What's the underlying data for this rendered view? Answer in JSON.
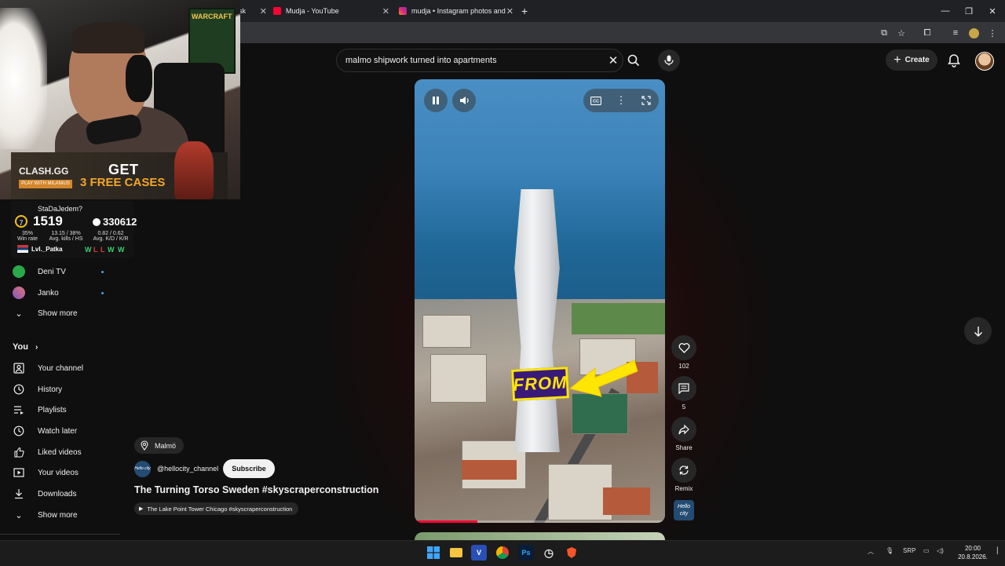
{
  "browser": {
    "tabs": [
      {
        "label": "sk",
        "active": true
      },
      {
        "label": "Mudja - YouTube",
        "active": false
      },
      {
        "label": "mudja • Instagram photos and",
        "active": false
      }
    ],
    "new_tab": "+"
  },
  "youtube": {
    "search": {
      "query": "malmo shipwork turned into apartments"
    },
    "create_label": "Create"
  },
  "stream_overlay": {
    "ad_logo": "CLASH.GG",
    "ad_logo_sub": "PLAY WITH MILANIUS",
    "ad_line1": "GET",
    "ad_line2": "3 FREE CASES",
    "poster_text": "WARCRAFT",
    "faceit": {
      "username": "StaDaJedem?",
      "level": "7",
      "elo": "1519",
      "points": "330612",
      "win_rate": "35%",
      "win_rate_label": "Win rate",
      "avg_kills": "13.15 / 38%",
      "avg_kills_label": "Avg. kills / HS",
      "avg_kd": "0.82 / 0.62",
      "avg_kd_label": "Avg. K/D / K/R",
      "nick": "Lvl._Patka",
      "recent": [
        "W",
        "L",
        "L",
        "W",
        "W"
      ]
    }
  },
  "sidebar": {
    "subscriptions": [
      {
        "label": "Deni TV"
      },
      {
        "label": "Janko"
      }
    ],
    "show_more_1": "Show more",
    "you_label": "You",
    "you_items": [
      {
        "label": "Your channel",
        "icon": "person-icon"
      },
      {
        "label": "History",
        "icon": "history-icon"
      },
      {
        "label": "Playlists",
        "icon": "playlists-icon"
      },
      {
        "label": "Watch later",
        "icon": "clock-icon"
      },
      {
        "label": "Liked videos",
        "icon": "thumb-up-icon"
      },
      {
        "label": "Your videos",
        "icon": "video-icon"
      },
      {
        "label": "Downloads",
        "icon": "download-icon"
      }
    ],
    "show_more_2": "Show more"
  },
  "short": {
    "overlay_word": "FROM",
    "location": "Malmö",
    "channel": "@hellocity_channel",
    "subscribe_label": "Subscribe",
    "title": "The Turning Torso Sweden #skyscraperconstruction",
    "related": "The Lake Point Tower Chicago #skyscraperconstruction",
    "progress": 0.25,
    "channel_logo_text": "Hello city"
  },
  "actions": {
    "likes": "102",
    "comments": "5",
    "share": "Share",
    "remix": "Remix"
  },
  "taskbar": {
    "language": "SRP",
    "time": "20:00",
    "date": "20.8.2026."
  },
  "colors": {
    "yt_bg": "#0f0f0f",
    "accent_red": "#ff0033",
    "chip_bg": "#272727",
    "overlay_yellow": "#ffe600"
  }
}
